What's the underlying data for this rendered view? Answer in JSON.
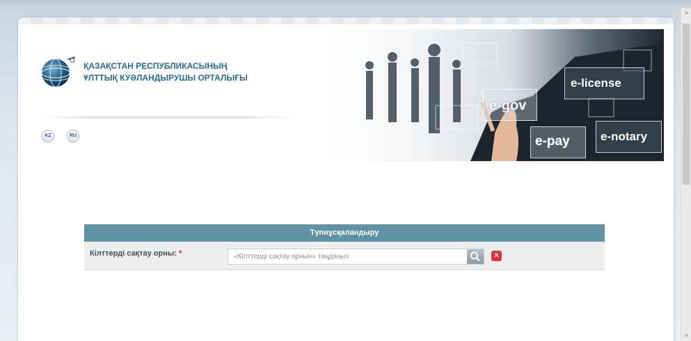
{
  "header": {
    "org_line1": "ҚАЗАҚСТАН РЕСПУБЛИКАСЫНЫҢ",
    "org_line2": "ҰЛТТЫҚ КУӘЛАНДЫРУШЫ ОРТАЛЫҒЫ",
    "lang_kz": "KZ",
    "lang_ru": "RU"
  },
  "banner": {
    "tiles": [
      "egov",
      "elicense",
      "epay",
      "enotary"
    ],
    "egov": "e-gov",
    "elicense": "e-license",
    "epay": "e-pay",
    "enotary": "e-notary"
  },
  "auth": {
    "title": "Түпнұсқаландыру",
    "key_storage_label": "Кілттерді сақтау орны:",
    "required_mark": "*",
    "key_storage_placeholder": "«Кілттерді сақтау орнын» таңдаңыз",
    "key_storage_value": "",
    "clear_symbol": "×"
  },
  "icons": {
    "search": "search-icon",
    "clear": "close-icon",
    "logo": "globe-logo",
    "scroll_up": "chevron-up-icon",
    "scroll_down": "chevron-down-icon"
  },
  "colors": {
    "org_name": "#2a6a8c",
    "auth_header": "#5f92a4",
    "required": "#d42020",
    "clear_button": "#d9383a"
  },
  "scroll": {
    "up_glyph": "˄",
    "down_glyph": "˅"
  }
}
